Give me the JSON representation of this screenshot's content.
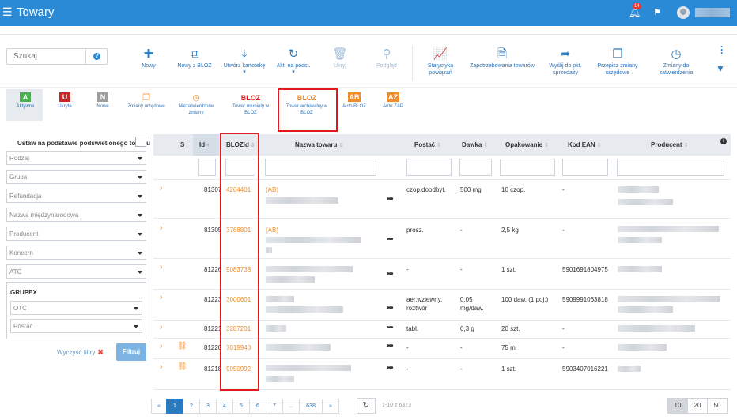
{
  "app": {
    "title": "Towary",
    "notifications_count": "14"
  },
  "search": {
    "placeholder": "Szukaj",
    "help_icon": "?"
  },
  "toolbar": [
    {
      "label": "Nowy",
      "icon": "plus-icon",
      "glyph": "✚"
    },
    {
      "label": "Nowy z BLOZ",
      "icon": "copy-icon",
      "glyph": "⧉"
    },
    {
      "label": "Utwórz kartotekę",
      "icon": "download-icon",
      "glyph": "⤓"
    },
    {
      "label": "Akt. na podst.",
      "icon": "refresh-icon",
      "glyph": "↻"
    },
    {
      "label": "Ukryj",
      "icon": "trash-icon",
      "glyph": "🗑"
    },
    {
      "label": "Podgląd",
      "icon": "magnifier-icon",
      "glyph": "⚲"
    },
    {
      "label": "Statystyka powiązań",
      "icon": "line-chart-icon",
      "glyph": "📈"
    },
    {
      "label": "Zapotrzebowania towarów",
      "icon": "document-icon",
      "glyph": "🗎"
    },
    {
      "label": "Wyślij do pkt. sprzedaży",
      "icon": "share-icon",
      "glyph": "➦"
    },
    {
      "label": "Przepisz zmiany urzędowe",
      "icon": "copy-files-icon",
      "glyph": "❐"
    },
    {
      "label": "Zmiany do zatwierdzenia",
      "icon": "clock-icon",
      "glyph": "◷"
    }
  ],
  "status_filters": [
    {
      "letter": "A",
      "label": "Aktywne",
      "color": "#4caf50"
    },
    {
      "letter": "U",
      "label": "Ukryte",
      "color": "#c62828"
    },
    {
      "letter": "N",
      "label": "Nowe",
      "color": "#9e9e9e"
    }
  ],
  "source_filters": {
    "official_changes": "Zmiany urzędowe",
    "unapproved_changes": "Niezatwierdzone zmiany",
    "removed_bloz_logo": "BLOZ",
    "removed_bloz": "Towar usunięty w BLOZ",
    "archived_bloz_logo": "BLOZ",
    "archived_bloz": "Towar archiwalny w BLOZ",
    "auto_bloz_badge": "AB",
    "auto_bloz": "Auto BLOZ",
    "auto_zap_badge": "AZ",
    "auto_zap": "Auto ZAP"
  },
  "left_panel": {
    "title": "Ustaw na podstawie podświetlonego towaru",
    "selects": [
      "Rodzaj",
      "Grupa",
      "Refundacja",
      "Nazwa międzynarodowa",
      "Producent",
      "Koncern",
      "ATC"
    ],
    "grupex_title": "GRUPEX",
    "grupex_selects": [
      "OTC",
      "Postać"
    ],
    "clear_label": "Wyczyść filtry",
    "filter_label": "Filtruj"
  },
  "table": {
    "headers": {
      "s": "S",
      "id": "Id",
      "blozid": "BLOZid",
      "name": "Nazwa towaru",
      "form": "Postać",
      "dose": "Dawka",
      "package": "Opakowanie",
      "ean": "Kod EAN",
      "producer": "Producent"
    },
    "rows": [
      {
        "id": "81307",
        "bloz": "4264401",
        "name_prefix": "(AB)",
        "form": "czop.doodbyt.",
        "dose": "500 mg",
        "package": "10 czop.",
        "ean": "-"
      },
      {
        "id": "81305",
        "bloz": "3768801",
        "name_prefix": "(AB)",
        "form": "prosz.",
        "dose": "-",
        "package": "2,5 kg",
        "ean": "-"
      },
      {
        "id": "81226",
        "bloz": "9083738",
        "name_prefix": "",
        "form": "-",
        "dose": "-",
        "package": "1 szt.",
        "ean": "5901691804975"
      },
      {
        "id": "81223",
        "bloz": "3000601",
        "name_prefix": "",
        "form": "aer.wziewny, roztwór",
        "dose": "0,05 mg/daw.",
        "package": "100 daw. (1 poj.)",
        "ean": "5909991063818"
      },
      {
        "id": "81221",
        "bloz": "3287201",
        "name_prefix": "",
        "form": "tabl.",
        "dose": "0,3 g",
        "package": "20 szt.",
        "ean": "-"
      },
      {
        "id": "81220",
        "bloz": "7019940",
        "name_prefix": "",
        "form": "-",
        "dose": "-",
        "package": "75 ml",
        "ean": "-"
      },
      {
        "id": "81218",
        "bloz": "9050992",
        "name_prefix": "",
        "form": "-",
        "dose": "-",
        "package": "1 szt.",
        "ean": "5903407016221"
      }
    ],
    "more_icon": "•••"
  },
  "pagination": {
    "prev": "«",
    "next": "»",
    "ellipsis": "...",
    "pages": [
      "1",
      "2",
      "3",
      "4",
      "5",
      "6",
      "7"
    ],
    "last": "638",
    "info": "1-10 z 6373",
    "sizes": [
      "10",
      "20",
      "50"
    ]
  }
}
